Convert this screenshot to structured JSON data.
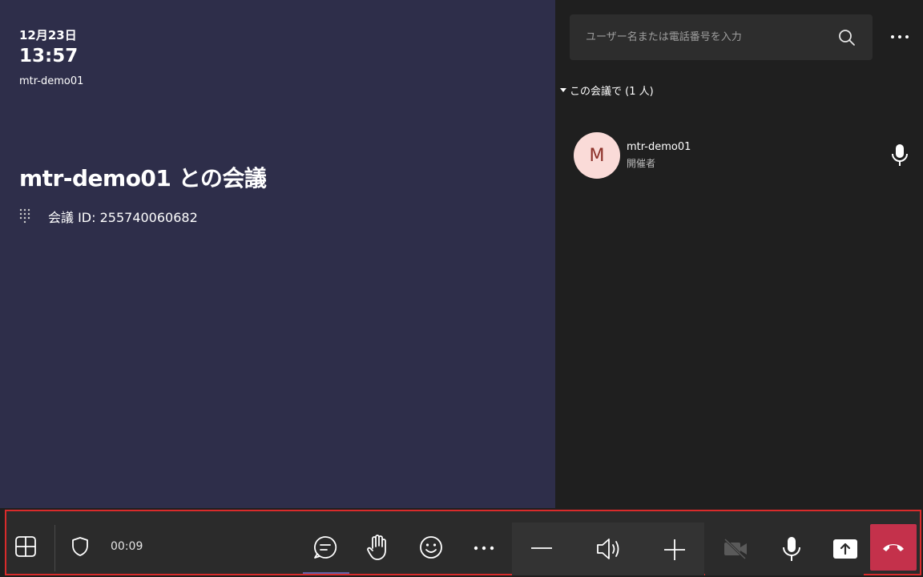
{
  "stage": {
    "date": "12月23日",
    "time": "13:57",
    "room_name": "mtr-demo01",
    "meeting_title": "mtr-demo01 との会議",
    "meeting_id": "会議 ID: 255740060682"
  },
  "panel": {
    "search_placeholder": "ユーザー名または電話番号を入力",
    "section_header": "この会議で (1 人)",
    "participant": {
      "initial": "M",
      "name": "mtr-demo01",
      "role": "開催者"
    }
  },
  "toolbar": {
    "timer": "00:09"
  },
  "colors": {
    "stage_bg": "#2e2e4a",
    "panel_bg": "#1f1f1f",
    "toolbar_bg": "#2b2b2b",
    "highlight_border": "#d92b2b",
    "hangup": "#c4314b",
    "avatar_bg": "#fadbd8",
    "avatar_text": "#8b2f27"
  },
  "icons": [
    "dialpad-icon",
    "search-icon",
    "more-icon",
    "caret-down-icon",
    "microphone-icon",
    "layout-icon",
    "shield-icon",
    "chat-icon",
    "raise-hand-icon",
    "reaction-icon",
    "volume-down-icon",
    "speaker-icon",
    "volume-up-icon",
    "camera-off-icon",
    "share-icon",
    "hang-up-icon"
  ]
}
